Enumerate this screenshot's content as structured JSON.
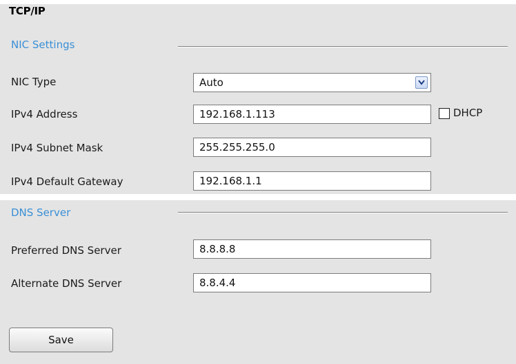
{
  "page": {
    "title": "TCP/IP"
  },
  "nic_settings": {
    "title": "NIC Settings",
    "nic_type": {
      "label": "NIC Type",
      "value": "Auto"
    },
    "ipv4_address": {
      "label": "IPv4 Address",
      "value": "192.168.1.113"
    },
    "dhcp": {
      "label": "DHCP",
      "checked": false
    },
    "ipv4_subnet_mask": {
      "label": "IPv4 Subnet Mask",
      "value": "255.255.255.0"
    },
    "ipv4_default_gateway": {
      "label": "IPv4 Default Gateway",
      "value": "192.168.1.1"
    }
  },
  "dns_server": {
    "title": "DNS Server",
    "preferred": {
      "label": "Preferred DNS Server",
      "value": "8.8.8.8"
    },
    "alternate": {
      "label": "Alternate DNS Server",
      "value": "8.8.4.4"
    }
  },
  "actions": {
    "save_label": "Save"
  },
  "colors": {
    "section_title": "#3a8fd6",
    "panel_bg": "#e4e4e4"
  },
  "icons": {
    "dropdown": "chevron-down-icon"
  }
}
